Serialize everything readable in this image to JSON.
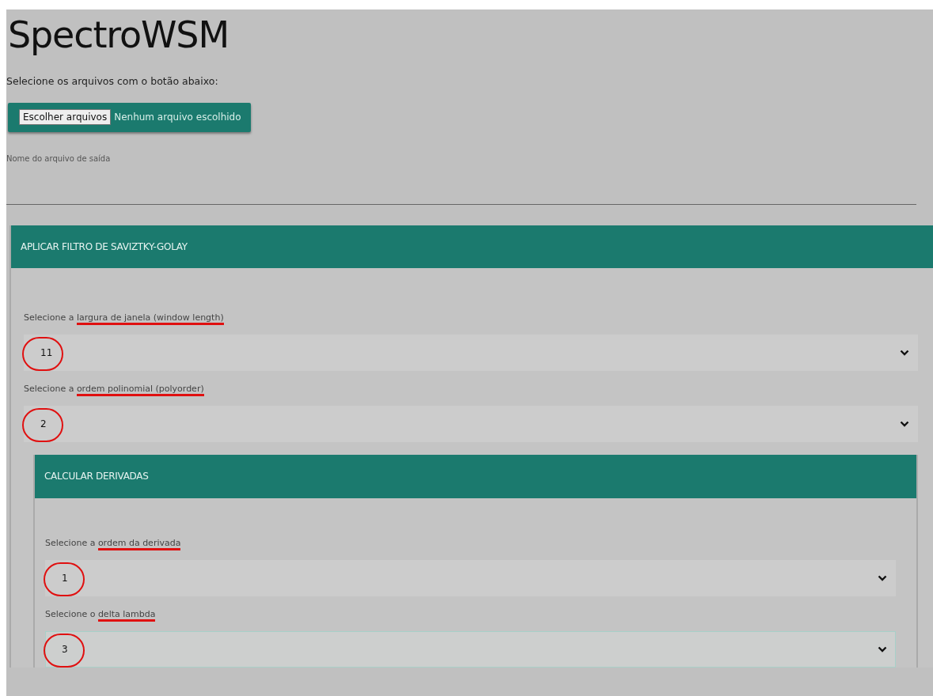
{
  "title": "SpectroWSM",
  "file_prompt": "Selecione os arquivos com o botão abaixo:",
  "file_input": {
    "button": "Escolher arquivos",
    "status": "Nenhum arquivo escolhido"
  },
  "output_name": {
    "placeholder": "Nome do arquivo de saída"
  },
  "panel": {
    "header": "APLICAR FILTRO DE SAVIZTKY-GOLAY",
    "fields": [
      {
        "label_prefix": "Selecione a ",
        "label_marked": "largura de janela (window length)",
        "value": "11",
        "circled": true,
        "focused": false
      },
      {
        "label_prefix": "Selecione a ",
        "label_marked": "ordem polinomial (polyorder)",
        "value": "2",
        "circled": true,
        "focused": false
      }
    ],
    "subpanel": {
      "header": "CALCULAR DERIVADAS",
      "fields": [
        {
          "label_prefix": "Selecione a ",
          "label_marked": "ordem da derivada",
          "value": "1",
          "circled": true,
          "focused": false
        },
        {
          "label_prefix": "Selecione o ",
          "label_marked": "delta lambda",
          "value": "3",
          "circled": true,
          "focused": true
        }
      ]
    }
  }
}
